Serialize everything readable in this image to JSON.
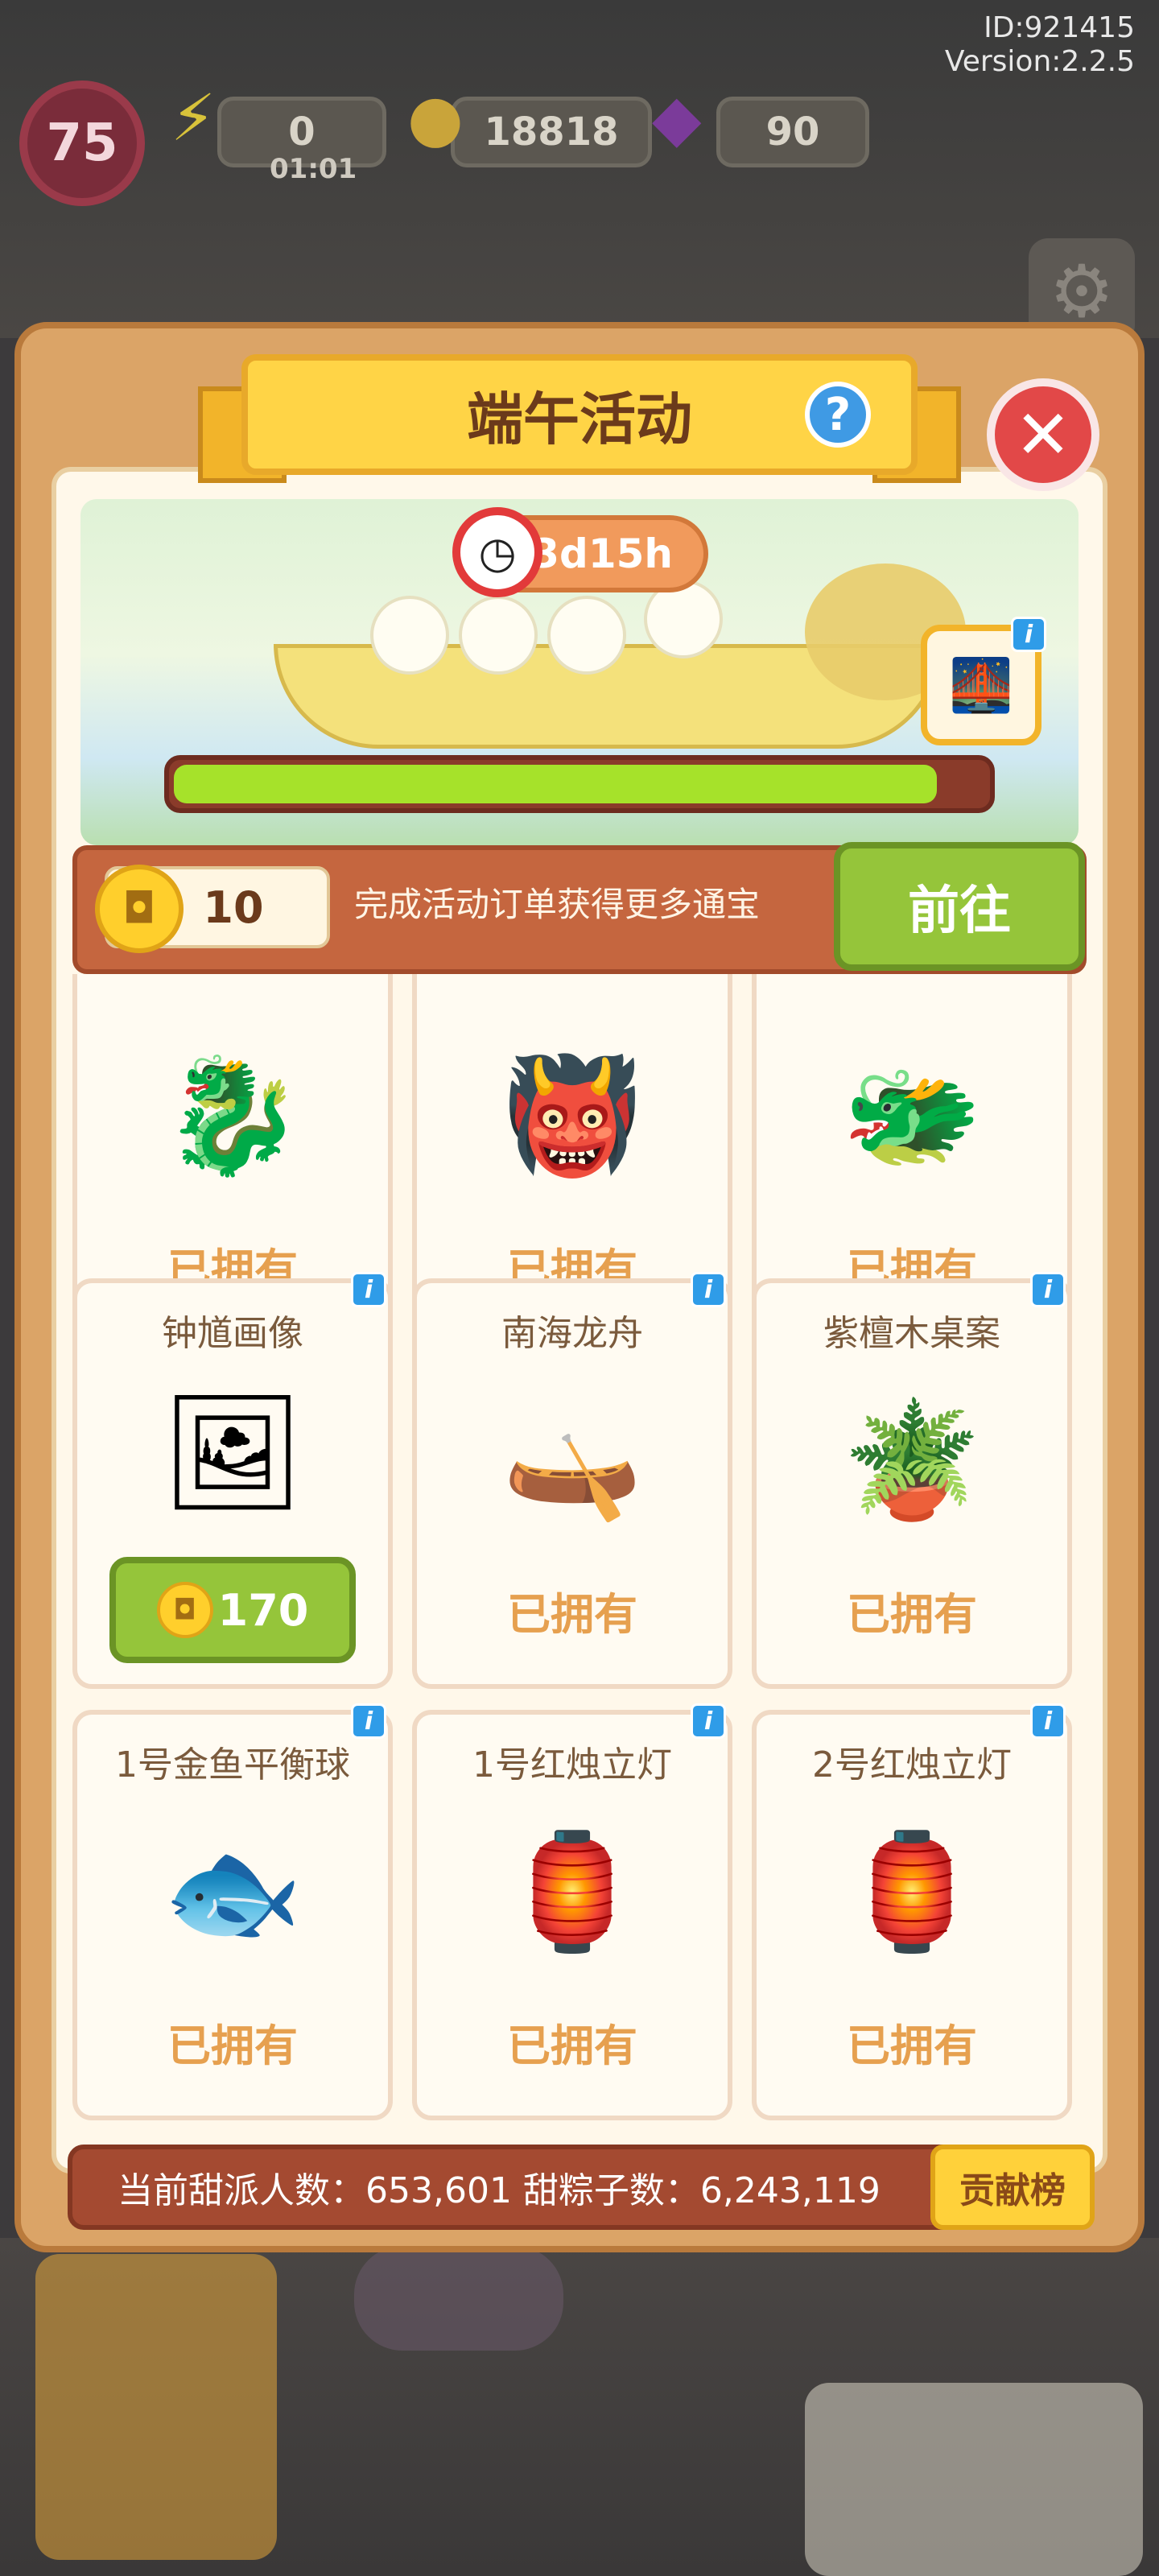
{
  "meta": {
    "id": "ID:921415",
    "version": "Version:2.2.5"
  },
  "hud": {
    "level": "75",
    "energy": {
      "value": "0",
      "timer": "01:01",
      "icon": "lightning-icon"
    },
    "coins": {
      "value": "18818",
      "icon": "coin-icon"
    },
    "gems": {
      "value": "90",
      "icon": "gem-icon"
    }
  },
  "panel": {
    "title": "端午活动",
    "help_label": "?",
    "close_label": "✕",
    "timer": "3d15h",
    "progress": 0.94,
    "reward_icon": "bridge-reward-icon",
    "currency": {
      "count": "10",
      "description": "完成活动订单获得更多通宝",
      "go_label": "前往"
    }
  },
  "items": [
    {
      "name": "",
      "status": "已拥有",
      "icon": "dragon-boat-green-icon",
      "art": "🐉"
    },
    {
      "name": "",
      "status": "已拥有",
      "icon": "zhong-kui-figure-icon",
      "art": "👹"
    },
    {
      "name": "",
      "status": "已拥有",
      "icon": "dragon-boat-black-icon",
      "art": "🐲"
    },
    {
      "name": "钟馗画像",
      "price": "170",
      "icon": "zhong-kui-painting-icon",
      "art": "🖼"
    },
    {
      "name": "南海龙舟",
      "status": "已拥有",
      "icon": "south-sea-dragon-boat-icon",
      "art": "🛶"
    },
    {
      "name": "紫檀木桌案",
      "status": "已拥有",
      "icon": "rosewood-table-icon",
      "art": "🪴"
    },
    {
      "name": "1号金鱼平衡球",
      "status": "已拥有",
      "icon": "goldfish-balance-ball-icon",
      "art": "🐟"
    },
    {
      "name": "1号红烛立灯",
      "status": "已拥有",
      "icon": "red-candle-lamp-icon",
      "art": "🏮"
    },
    {
      "name": "2号红烛立灯",
      "status": "已拥有",
      "icon": "red-candle-lamp-icon",
      "art": "🏮"
    }
  ],
  "stats": {
    "text": "当前甜派人数：653,601    甜粽子数：6,243,119",
    "rank_label": "贡献榜"
  },
  "colors": {
    "panel": "#dba467",
    "title_banner": "#ffd446",
    "go_button": "#95c53a",
    "owned_text": "#e6a04f",
    "stats_bar": "#a44a31",
    "rank_button": "#ffd13a"
  }
}
